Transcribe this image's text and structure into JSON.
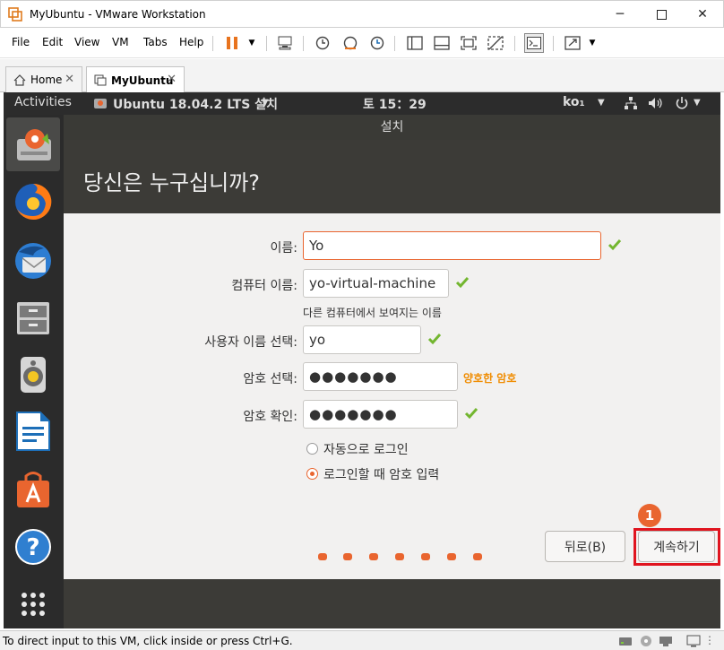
{
  "window": {
    "title": "MyUbuntu - VMware Workstation"
  },
  "menu": [
    "File",
    "Edit",
    "View",
    "VM",
    "Tabs",
    "Help"
  ],
  "tabs": [
    {
      "label": "Home"
    },
    {
      "label": "MyUbuntu"
    }
  ],
  "gnome": {
    "activities": "Activities",
    "app_menu": "Ubuntu 18.04.2 LTS 설치",
    "clock": "토 15：29",
    "input_method": "ko₁"
  },
  "installer": {
    "window_title": "설치",
    "heading": "당신은 누구십니까?",
    "fields": {
      "name_label": "이름:",
      "name_value": "Yo",
      "computer_label": "컴퓨터 이름:",
      "computer_value": "yo-virtual-machine",
      "computer_hint": "다른 컴퓨터에서 보여지는 이름",
      "username_label": "사용자 이름 선택:",
      "username_value": "yo",
      "password_label": "암호 선택:",
      "password_value": "●●●●●●●",
      "password_strength": "양호한 암호",
      "confirm_label": "암호 확인:",
      "confirm_value": "●●●●●●●"
    },
    "login_options": [
      {
        "label": "자동으로 로그인",
        "selected": false
      },
      {
        "label": "로그인할 때 암호 입력",
        "selected": true
      }
    ],
    "buttons": {
      "back": "뒤로(B)",
      "continue": "계속하기"
    },
    "annotation_marker": "1"
  },
  "statusbar": {
    "text": "To direct input to this VM, click inside or press Ctrl+G."
  },
  "colors": {
    "ubuntu_orange": "#e9652f",
    "check_green": "#73b62f",
    "highlight_red": "#e0141e"
  }
}
